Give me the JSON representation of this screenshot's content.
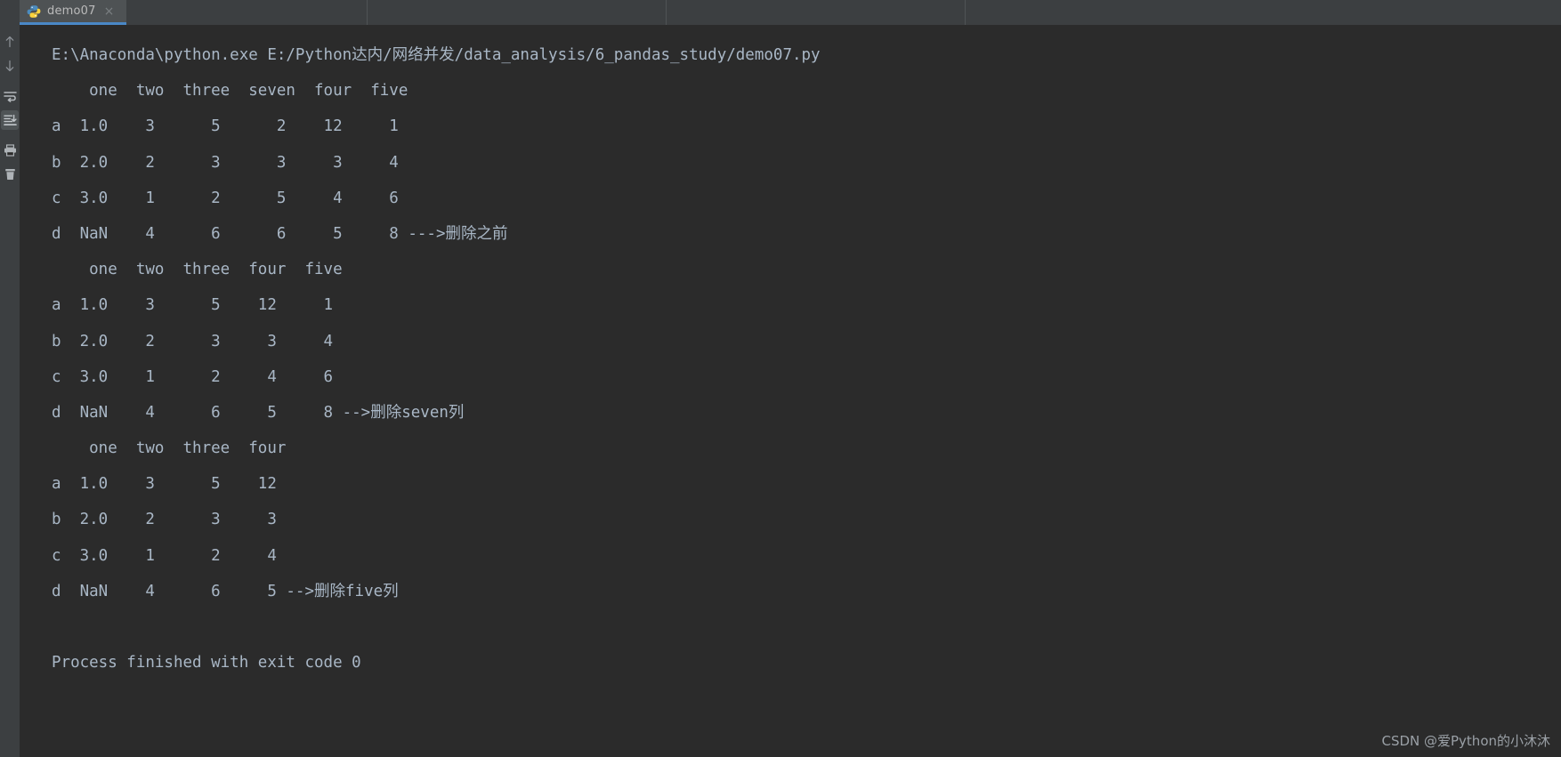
{
  "window": {
    "tab": {
      "label": "demo07",
      "icon": "python-file-icon",
      "close": "×"
    }
  },
  "toolbar": {
    "items": [
      {
        "name": "scroll-up-icon",
        "title": "Up the stack trace"
      },
      {
        "name": "scroll-down-icon",
        "title": "Down the stack trace"
      },
      {
        "name": "soft-wrap-icon",
        "title": "Soft-Wrap"
      },
      {
        "name": "scroll-to-end-icon",
        "title": "Scroll to the end",
        "active": true
      },
      {
        "name": "print-icon",
        "title": "Print"
      },
      {
        "name": "trash-icon",
        "title": "Clear All"
      }
    ]
  },
  "console": {
    "command": "E:\\Anaconda\\python.exe E:/Python达内/网络并发/data_analysis/6_pandas_study/demo07.py",
    "lines": [
      "    one  two  three  seven  four  five",
      "a  1.0    3      5      2    12     1",
      "b  2.0    2      3      3     3     4",
      "c  3.0    1      2      5     4     6",
      "d  NaN    4      6      6     5     8 --->删除之前",
      "    one  two  three  four  five",
      "a  1.0    3      5    12     1",
      "b  2.0    2      3     3     4",
      "c  3.0    1      2     4     6",
      "d  NaN    4      6     5     8 -->删除seven列",
      "    one  two  three  four",
      "a  1.0    3      5    12",
      "b  2.0    2      3     3",
      "c  3.0    1      2     4",
      "d  NaN    4      6     5 -->删除five列",
      "",
      "Process finished with exit code 0"
    ],
    "exit_message": "Process finished with exit code 0"
  },
  "watermark": {
    "text": "CSDN @爱Python的小沐沐"
  },
  "colors": {
    "console_bg": "#2b2b2b",
    "chrome_bg": "#3c3f41",
    "tab_active_bg": "#4e5254",
    "tab_underline": "#4a88c7",
    "text": "#a9b7c6",
    "tab_text": "#bbbbbb",
    "watermark_text": "#9aa0a6"
  },
  "table_data": [
    {
      "columns": [
        "one",
        "two",
        "three",
        "seven",
        "four",
        "five"
      ],
      "index": [
        "a",
        "b",
        "c",
        "d"
      ],
      "rows": [
        [
          "1.0",
          "3",
          "5",
          "2",
          "12",
          "1"
        ],
        [
          "2.0",
          "2",
          "3",
          "3",
          "3",
          "4"
        ],
        [
          "3.0",
          "1",
          "2",
          "5",
          "4",
          "6"
        ],
        [
          "NaN",
          "4",
          "6",
          "6",
          "5",
          "8"
        ]
      ],
      "annotation": "--->删除之前"
    },
    {
      "columns": [
        "one",
        "two",
        "three",
        "four",
        "five"
      ],
      "index": [
        "a",
        "b",
        "c",
        "d"
      ],
      "rows": [
        [
          "1.0",
          "3",
          "5",
          "12",
          "1"
        ],
        [
          "2.0",
          "2",
          "3",
          "3",
          "4"
        ],
        [
          "3.0",
          "1",
          "2",
          "4",
          "6"
        ],
        [
          "NaN",
          "4",
          "6",
          "5",
          "8"
        ]
      ],
      "annotation": "-->删除seven列"
    },
    {
      "columns": [
        "one",
        "two",
        "three",
        "four"
      ],
      "index": [
        "a",
        "b",
        "c",
        "d"
      ],
      "rows": [
        [
          "1.0",
          "3",
          "5",
          "12"
        ],
        [
          "2.0",
          "2",
          "3",
          "3"
        ],
        [
          "3.0",
          "1",
          "2",
          "4"
        ],
        [
          "NaN",
          "4",
          "6",
          "5"
        ]
      ],
      "annotation": "-->删除five列"
    }
  ]
}
